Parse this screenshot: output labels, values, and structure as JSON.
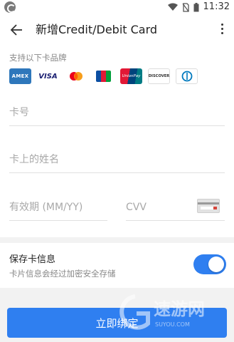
{
  "status_bar": {
    "time": "11:32"
  },
  "app_bar": {
    "title": "新增Credit/Debit Card"
  },
  "brands": {
    "label": "支持以下卡品牌",
    "items": [
      {
        "name": "amex-logo",
        "text": "AMEX",
        "color": "#2e77bb"
      },
      {
        "name": "visa-logo",
        "text": "VISA",
        "color": "#1a1f71"
      },
      {
        "name": "mastercard-logo",
        "text": "",
        "color": "#eb001b"
      },
      {
        "name": "jcb-logo",
        "text": "JCB",
        "color": "#0b4ea2"
      },
      {
        "name": "unionpay-logo",
        "text": "UnionPay",
        "color": "#e21836"
      },
      {
        "name": "discover-logo",
        "text": "DISCOVER",
        "color": "#f58220"
      },
      {
        "name": "diners-logo",
        "text": "",
        "color": "#0079be"
      }
    ]
  },
  "form": {
    "card_number_placeholder": "卡号",
    "card_name_placeholder": "卡上的姓名",
    "expiry_placeholder": "有效期 (MM/YY)",
    "cvv_placeholder": "CVV"
  },
  "save_card": {
    "title": "保存卡信息",
    "subtitle": "卡片信息会经过加密安全存储",
    "enabled": true
  },
  "submit_label": "立即绑定",
  "watermark": {
    "name": "速游网",
    "domain": "SUYOU.COM"
  },
  "colors": {
    "accent": "#2f7ff0"
  }
}
